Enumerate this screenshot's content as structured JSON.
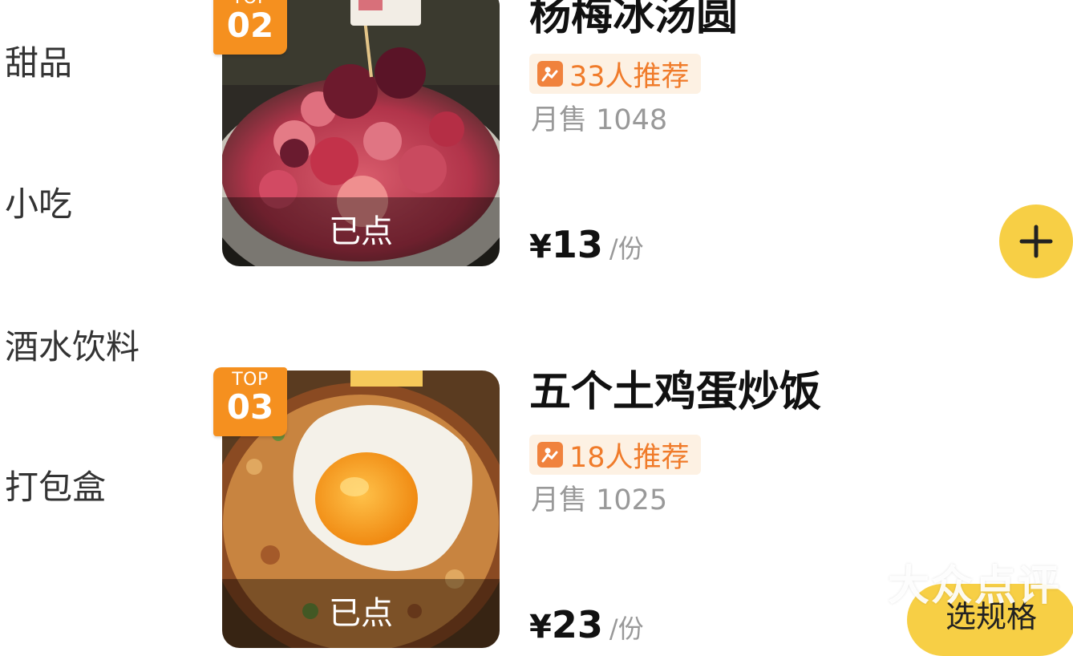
{
  "sidebar": {
    "items": [
      {
        "label": "甜品"
      },
      {
        "label": "小吃"
      },
      {
        "label": "酒水饮料"
      },
      {
        "label": "打包盒"
      }
    ]
  },
  "dishes": [
    {
      "rank_label": "TOP",
      "rank_number": "02",
      "name": "杨梅冰汤圆",
      "recommend": "33人推荐",
      "monthly_sales": "月售 1048",
      "ordered_label": "已点",
      "price_symbol": "¥",
      "price": "13",
      "unit": "/份",
      "action": "add"
    },
    {
      "rank_label": "TOP",
      "rank_number": "03",
      "name": "五个土鸡蛋炒饭",
      "recommend": "18人推荐",
      "monthly_sales": "月售 1025",
      "ordered_label": "已点",
      "price_symbol": "¥",
      "price": "23",
      "unit": "/份",
      "action_label": "选规格"
    }
  ],
  "watermark": "大众点评",
  "colors": {
    "accent_yellow": "#f7cf45",
    "top_badge_orange": "#f5901f",
    "recommend_text": "#f07b2a",
    "recommend_bg": "#fdf1e3",
    "muted_text": "#999999"
  },
  "icons": {
    "recommend": "thumbs-person-icon",
    "add": "plus-icon",
    "watermark_logo": "dianping-people-icon"
  }
}
